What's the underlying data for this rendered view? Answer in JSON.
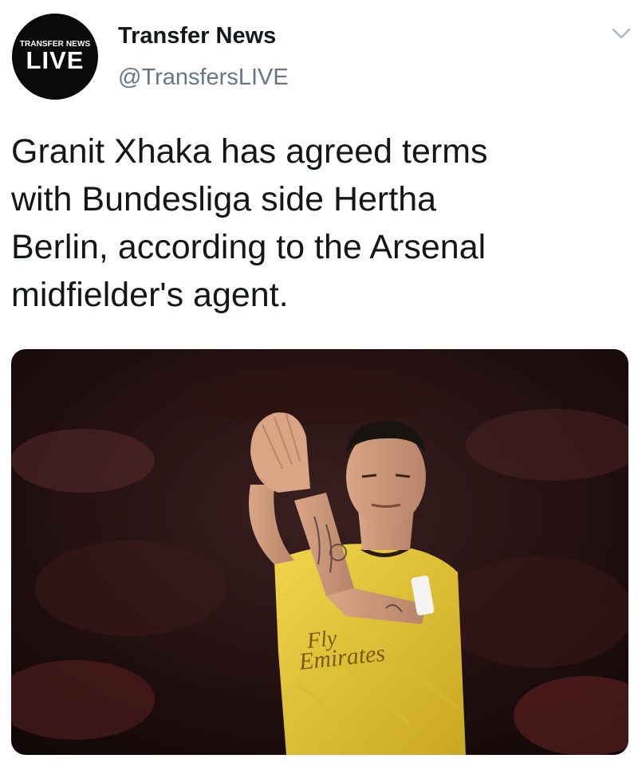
{
  "author": {
    "avatar_text_top": "TRANSFER NEWS",
    "avatar_text_bottom": "LIVE",
    "display_name": "Transfer News",
    "handle": "@TransfersLIVE"
  },
  "tweet": {
    "text": "Granit Xhaka has agreed terms\nwith Bundesliga side Hertha\nBerlin, according to the Arsenal\nmidfielder's agent."
  },
  "media": {
    "description_icon": "photo",
    "shirt_sponsor": "Fly\nEmirates"
  },
  "colors": {
    "name": "#14171a",
    "handle": "#657786",
    "shirt": "#e8c83a",
    "stadium_dark": "#1a0d0d"
  },
  "icons": {
    "menu": "chevron-down-icon"
  }
}
